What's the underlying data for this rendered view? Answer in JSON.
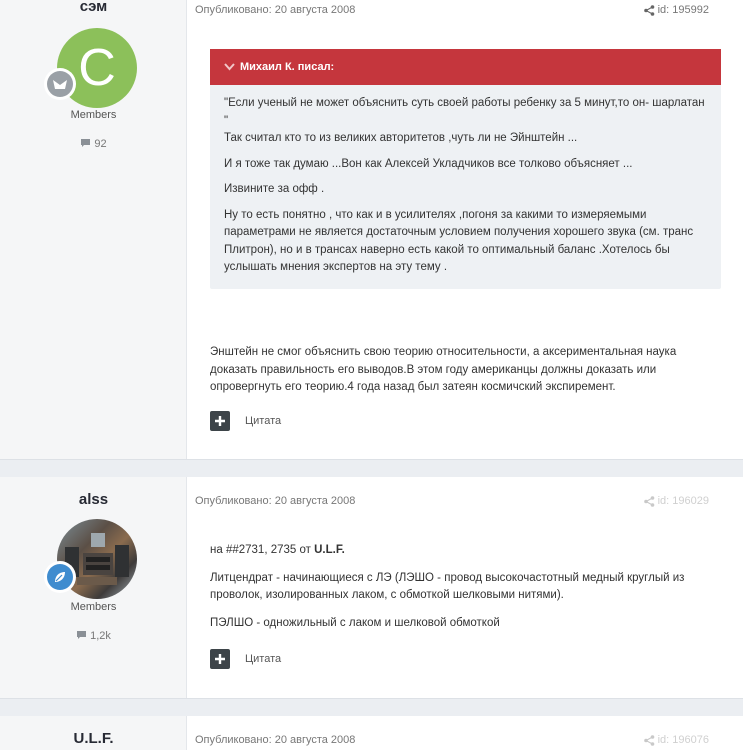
{
  "posts": [
    {
      "author": "сэм",
      "avatar_letter": "C",
      "group": "Members",
      "count": "92",
      "meta": "Опубликовано: 20 августа 2008",
      "id": "id: 195992",
      "quote": {
        "header": "Михаил К. писал:",
        "paragraphs": [
          "\"Если ученый не может объяснить суть своей работы ребенку за 5 минут,то он- шарлатан \"",
          "Так считал кто то из великих авторитетов ,чуть ли не Эйнштейн ...",
          "И я тоже так думаю ...Вон как Алексей Укладчиков все толково объясняет ...",
          "Извините за офф .",
          "Ну то есть понятно , что как и в усилителях ,погоня за какими то измеряемыми параметрами не является достаточным условием получения хорошего звука (см. транс Плитрон), но и в трансах наверно есть какой то оптимальный баланс .Хотелось бы услышать мнения экспертов на эту тему ."
        ]
      },
      "text": "Энштейн не смог объяснить свою теорию относительности, а аксериментальная наука доказать правильность его выводов.В этом году американцы должны доказать или опровергнуть его теорию.4 года назад был затеян космичский экспиремент.",
      "quote_label": "Цитата"
    },
    {
      "author": "alss",
      "group": "Members",
      "count": "1,2k",
      "meta": "Опубликовано: 20 августа 2008",
      "id": "id: 196029",
      "text_prefix": "на ##2731, 2735 от ",
      "text_bold": "U.L.F.",
      "text_p2": "Литцендрат - начинающиеся с ЛЭ (ЛЭШО - провод высокочастотный медный круглый из проволок, изолированных лаком, с обмоткой шелковыми нитями).",
      "text_p3": "ПЭЛШО - одножильный с лаком и шелковой обмоткой",
      "quote_label": "Цитата"
    },
    {
      "author": "U.L.F.",
      "meta": "Опубликовано: 20 августа 2008",
      "id": "id: 196076"
    }
  ]
}
